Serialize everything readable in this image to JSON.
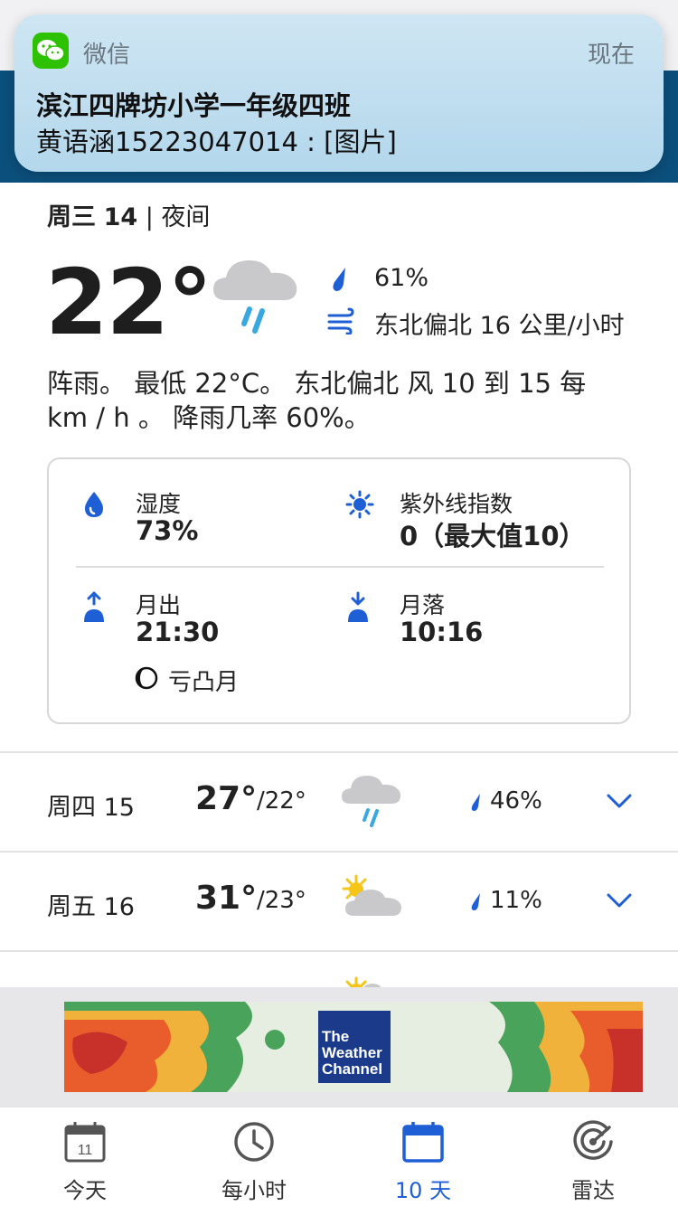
{
  "notification": {
    "app": "微信",
    "time": "现在",
    "title": "滨江四牌坊小学一年级四班",
    "body": "黄语涵15223047014 : [图片]",
    "icon": "wechat-icon"
  },
  "day": {
    "weekday": "周三",
    "date": "14",
    "period": "夜间",
    "temp": "22°",
    "condition_icon": "rain-cloud-icon",
    "precip": "61%",
    "wind": "东北偏北 16 公里/小时",
    "narrative": "阵雨。 最低 22°C。 东北偏北 风 10 到 15 每 km / h 。 降雨几率 60%。"
  },
  "details": {
    "humidity_label": "湿度",
    "humidity_value": "73%",
    "uv_label": "紫外线指数",
    "uv_value": "0（最大值10）",
    "moonrise_label": "月出",
    "moonrise_value": "21:30",
    "moonset_label": "月落",
    "moonset_value": "10:16",
    "moon_phase": "亏凸月"
  },
  "forecast": [
    {
      "day": "周四 15",
      "high": "27°",
      "low": "/22°",
      "icon": "rain-cloud-icon",
      "precip": "46%"
    },
    {
      "day": "周五 16",
      "high": "31°",
      "low": "/23°",
      "icon": "partly-cloudy-icon",
      "precip": "11%"
    }
  ],
  "ad": {
    "brand_line1": "The",
    "brand_line2": "Weather",
    "brand_line3": "Channel"
  },
  "tabs": [
    {
      "label": "今天",
      "icon": "calendar-day-icon",
      "badge": "11"
    },
    {
      "label": "每小时",
      "icon": "clock-icon"
    },
    {
      "label": "10 天",
      "icon": "calendar-icon"
    },
    {
      "label": "雷达",
      "icon": "radar-icon"
    }
  ],
  "colors": {
    "accent": "#1f5fd6",
    "header": "#0b4f7c",
    "rain": "#3aa8e0"
  }
}
